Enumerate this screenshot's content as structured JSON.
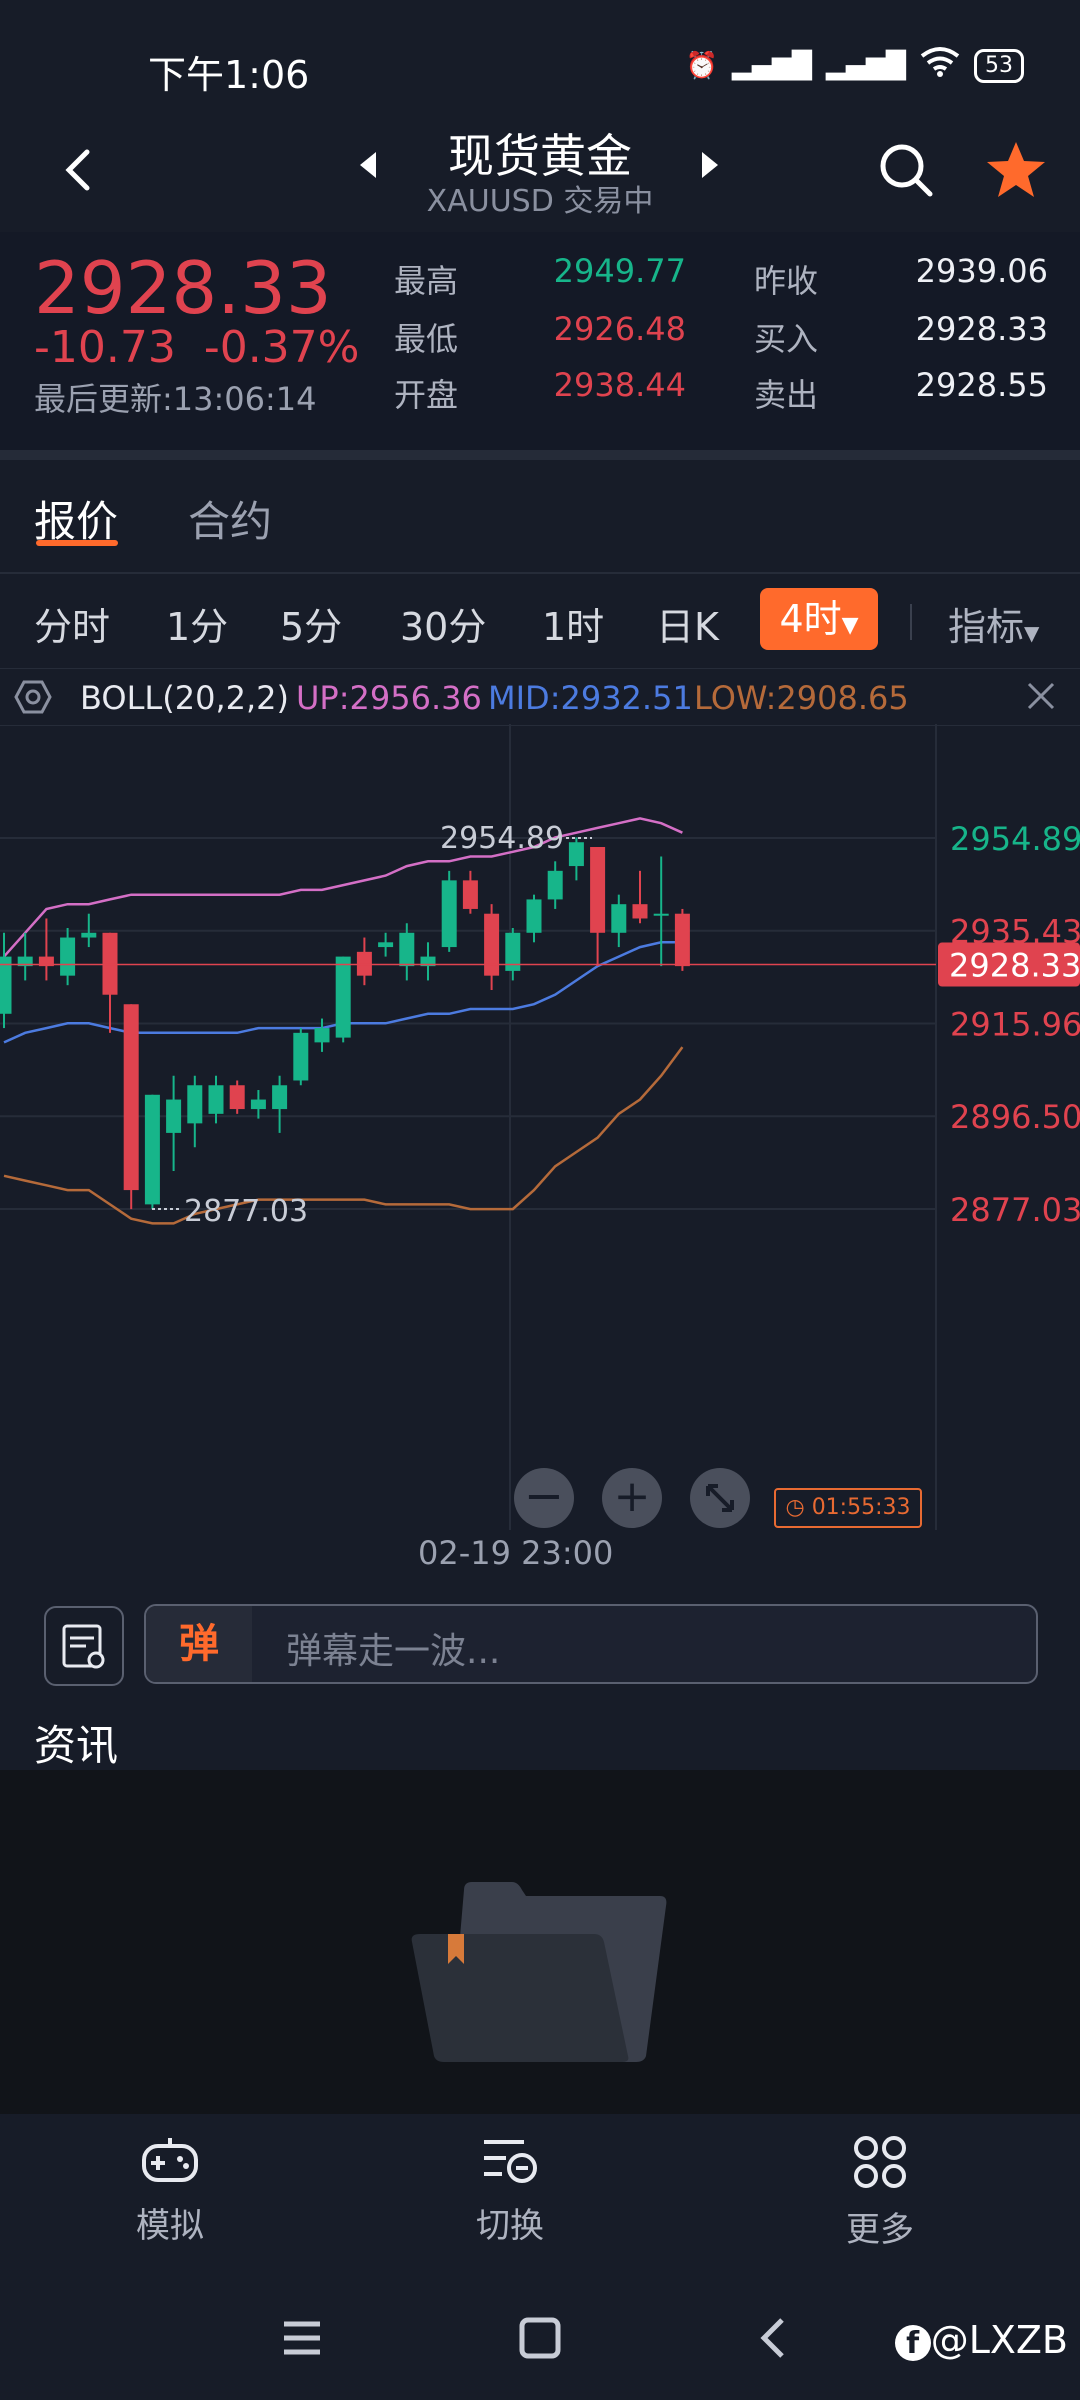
{
  "status_bar": {
    "time": "下午1:06",
    "battery": "53"
  },
  "header": {
    "title": "现货黄金",
    "subtitle": "XAUUSD 交易中"
  },
  "quote": {
    "price": "2928.33",
    "change": "-10.73",
    "change_pct": "-0.37%",
    "last_update": "最后更新:13:06:14",
    "high_label": "最高",
    "high": "2949.77",
    "low_label": "最低",
    "low": "2926.48",
    "open_label": "开盘",
    "open": "2938.44",
    "prev_close_label": "昨收",
    "prev_close": "2939.06",
    "bid_label": "买入",
    "bid": "2928.33",
    "ask_label": "卖出",
    "ask": "2928.55"
  },
  "tabs": [
    {
      "label": "报价"
    },
    {
      "label": "合约"
    }
  ],
  "periods": [
    "分时",
    "1分",
    "5分",
    "30分",
    "1时",
    "日K"
  ],
  "active_period": "4时",
  "indicators_label": "指标",
  "indicator": {
    "name": "BOLL(20,2,2)",
    "up": "UP:2956.36",
    "mid": "MID:2932.51",
    "low": "LOW:2908.65"
  },
  "chart": {
    "y_labels": [
      "2954.89",
      "2935.43",
      "2915.96",
      "2896.50",
      "2877.03"
    ],
    "current_price_tag": "2928.33",
    "high_annotation": "2954.89",
    "low_annotation": "2877.03",
    "countdown": "01:55:33",
    "date_label": "02-19 23:00"
  },
  "comment": {
    "badge": "弹",
    "placeholder": "弹幕走一波..."
  },
  "news": {
    "title": "资讯"
  },
  "bottom_nav": [
    {
      "label": "模拟",
      "icon": "gamepad-icon"
    },
    {
      "label": "切换",
      "icon": "switch-icon"
    },
    {
      "label": "更多",
      "icon": "more-grid-icon"
    }
  ],
  "watermark": "@LXZB",
  "colors": {
    "up": "#17b58a",
    "down": "#e0434f",
    "accent": "#ff6a2c",
    "boll_up": "#d46fc6",
    "boll_mid": "#4c7be0",
    "boll_low": "#b56a3a"
  },
  "chart_data": {
    "type": "candlestick",
    "symbol": "XAUUSD",
    "interval": "4时",
    "ylim": [
      2870,
      2965
    ],
    "candles": [
      {
        "o": 2918,
        "h": 2935,
        "l": 2915,
        "c": 2930
      },
      {
        "o": 2928,
        "h": 2935,
        "l": 2925,
        "c": 2930
      },
      {
        "o": 2930,
        "h": 2938,
        "l": 2925,
        "c": 2928
      },
      {
        "o": 2926,
        "h": 2936,
        "l": 2924,
        "c": 2934
      },
      {
        "o": 2934,
        "h": 2939,
        "l": 2932,
        "c": 2935
      },
      {
        "o": 2935,
        "h": 2935,
        "l": 2914,
        "c": 2922
      },
      {
        "o": 2920,
        "h": 2920,
        "l": 2877,
        "c": 2881
      },
      {
        "o": 2878,
        "h": 2901,
        "l": 2877,
        "c": 2901
      },
      {
        "o": 2893,
        "h": 2905,
        "l": 2885,
        "c": 2900
      },
      {
        "o": 2895,
        "h": 2905,
        "l": 2890,
        "c": 2903
      },
      {
        "o": 2897,
        "h": 2905,
        "l": 2895,
        "c": 2903
      },
      {
        "o": 2903,
        "h": 2904,
        "l": 2897,
        "c": 2898
      },
      {
        "o": 2898,
        "h": 2902,
        "l": 2896,
        "c": 2900
      },
      {
        "o": 2898,
        "h": 2905,
        "l": 2893,
        "c": 2903
      },
      {
        "o": 2904,
        "h": 2915,
        "l": 2903,
        "c": 2914
      },
      {
        "o": 2912,
        "h": 2917,
        "l": 2910,
        "c": 2915
      },
      {
        "o": 2913,
        "h": 2930,
        "l": 2912,
        "c": 2930
      },
      {
        "o": 2931,
        "h": 2934,
        "l": 2924,
        "c": 2926
      },
      {
        "o": 2932,
        "h": 2935,
        "l": 2930,
        "c": 2933
      },
      {
        "o": 2928,
        "h": 2937,
        "l": 2925,
        "c": 2935
      },
      {
        "o": 2928,
        "h": 2933,
        "l": 2925,
        "c": 2930
      },
      {
        "o": 2932,
        "h": 2948,
        "l": 2931,
        "c": 2946
      },
      {
        "o": 2946,
        "h": 2948,
        "l": 2939,
        "c": 2940
      },
      {
        "o": 2939,
        "h": 2941,
        "l": 2923,
        "c": 2926
      },
      {
        "o": 2927,
        "h": 2936,
        "l": 2925,
        "c": 2935
      },
      {
        "o": 2935,
        "h": 2943,
        "l": 2933,
        "c": 2942
      },
      {
        "o": 2942,
        "h": 2950,
        "l": 2940,
        "c": 2948
      },
      {
        "o": 2949,
        "h": 2955,
        "l": 2946,
        "c": 2954
      },
      {
        "o": 2953,
        "h": 2953,
        "l": 2928,
        "c": 2935
      },
      {
        "o": 2935,
        "h": 2943,
        "l": 2932,
        "c": 2941
      },
      {
        "o": 2941,
        "h": 2948,
        "l": 2937,
        "c": 2938
      },
      {
        "o": 2939,
        "h": 2951,
        "l": 2928,
        "c": 2939
      },
      {
        "o": 2939,
        "h": 2940,
        "l": 2927,
        "c": 2928
      }
    ],
    "boll_up": [
      2930,
      2935,
      2940,
      2941,
      2941,
      2942,
      2943,
      2943,
      2943,
      2943,
      2943,
      2943,
      2943,
      2943,
      2944,
      2944,
      2945,
      2946,
      2947,
      2949,
      2950,
      2950,
      2951,
      2951,
      2952,
      2953,
      2955,
      2956,
      2957,
      2958,
      2959,
      2958,
      2956
    ],
    "boll_mid": [
      2912,
      2914,
      2915,
      2916,
      2916,
      2915,
      2914,
      2914,
      2914,
      2914,
      2914,
      2914,
      2915,
      2915,
      2915,
      2915,
      2916,
      2916,
      2916,
      2917,
      2918,
      2918,
      2919,
      2919,
      2919,
      2920,
      2922,
      2925,
      2928,
      2930,
      2932,
      2933,
      2933
    ],
    "boll_low": [
      2884,
      2883,
      2882,
      2881,
      2881,
      2878,
      2875,
      2874,
      2874,
      2876,
      2877,
      2878,
      2879,
      2879,
      2879,
      2879,
      2879,
      2879,
      2878,
      2878,
      2878,
      2878,
      2877,
      2877,
      2877,
      2881,
      2886,
      2889,
      2892,
      2897,
      2900,
      2905,
      2911
    ]
  }
}
